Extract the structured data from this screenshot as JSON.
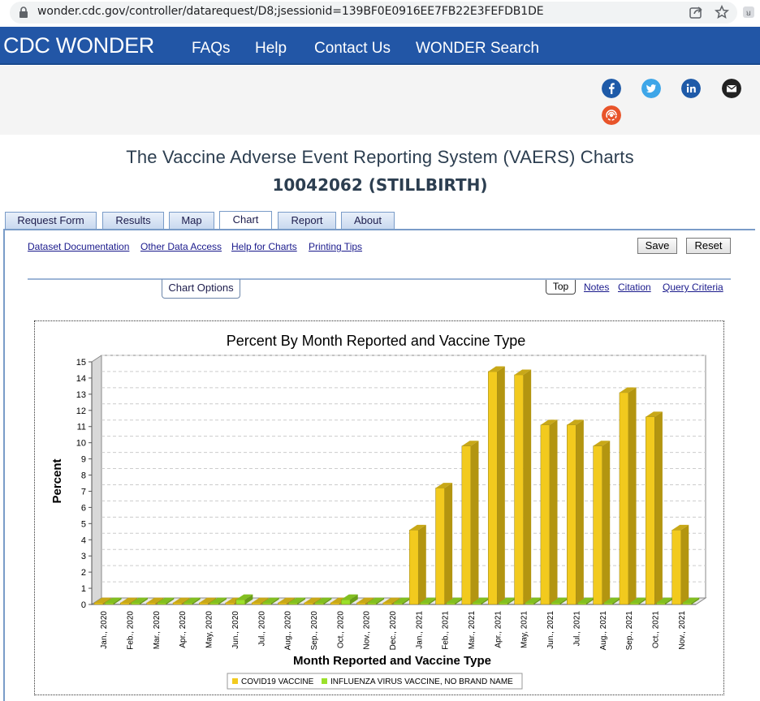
{
  "browser": {
    "url": "wonder.cdc.gov/controller/datarequest/D8;jsessionid=139BF0E0916EE7FB22E3FEFDB1DE"
  },
  "header": {
    "brand": "CDC WONDER",
    "nav": [
      "FAQs",
      "Help",
      "Contact Us",
      "WONDER Search"
    ]
  },
  "page": {
    "title": "The Vaccine Adverse Event Reporting System (VAERS) Charts",
    "subtitle": "10042062 (STILLBIRTH)"
  },
  "tabs": [
    "Request Form",
    "Results",
    "Map",
    "Chart",
    "Report",
    "About"
  ],
  "active_tab": "Chart",
  "links": [
    "Dataset Documentation",
    "Other Data Access",
    "Help for Charts",
    "Printing Tips"
  ],
  "buttons": {
    "save": "Save",
    "reset": "Reset"
  },
  "chart_options_label": "Chart Options",
  "section_links": {
    "top": "Top",
    "notes": "Notes",
    "citation": "Citation",
    "query": "Query Criteria"
  },
  "colors": {
    "brand_blue": "#2256a6",
    "covid": "#f2ca1e",
    "flu": "#9be02a"
  },
  "chart_data": {
    "type": "bar",
    "title": "Percent By Month Reported and Vaccine Type",
    "xlabel": "Month Reported and Vaccine Type",
    "ylabel": "Percent",
    "ylim": [
      0,
      15
    ],
    "yticks": [
      0,
      1,
      2,
      3,
      4,
      5,
      6,
      7,
      8,
      9,
      10,
      11,
      12,
      13,
      14,
      15
    ],
    "grid": true,
    "legend_position": "bottom",
    "categories": [
      "Jan., 2020",
      "Feb., 2020",
      "Mar., 2020",
      "Apr., 2020",
      "May, 2020",
      "Jun., 2020",
      "Jul., 2020",
      "Aug., 2020",
      "Sep., 2020",
      "Oct., 2020",
      "Nov., 2020",
      "Dec., 2020",
      "Jan., 2021",
      "Feb., 2021",
      "Mar., 2021",
      "Apr., 2021",
      "May, 2021",
      "Jun., 2021",
      "Jul., 2021",
      "Aug., 2021",
      "Sep., 2021",
      "Oct., 2021",
      "Nov., 2021"
    ],
    "series": [
      {
        "name": "COVID19 VACCINE",
        "values": [
          0,
          0,
          0,
          0,
          0,
          0,
          0,
          0,
          0,
          0,
          0,
          0,
          4.6,
          7.2,
          9.8,
          14.4,
          14.2,
          11.1,
          11.1,
          9.8,
          13.1,
          11.6,
          4.6
        ]
      },
      {
        "name": "INFLUENZA VIRUS VACCINE, NO BRAND NAME",
        "values": [
          0,
          0,
          0,
          0,
          0,
          0.3,
          0,
          0,
          0,
          0.3,
          0,
          0,
          0,
          0,
          0,
          0,
          0,
          0,
          0,
          0,
          0,
          0,
          0
        ]
      }
    ]
  }
}
